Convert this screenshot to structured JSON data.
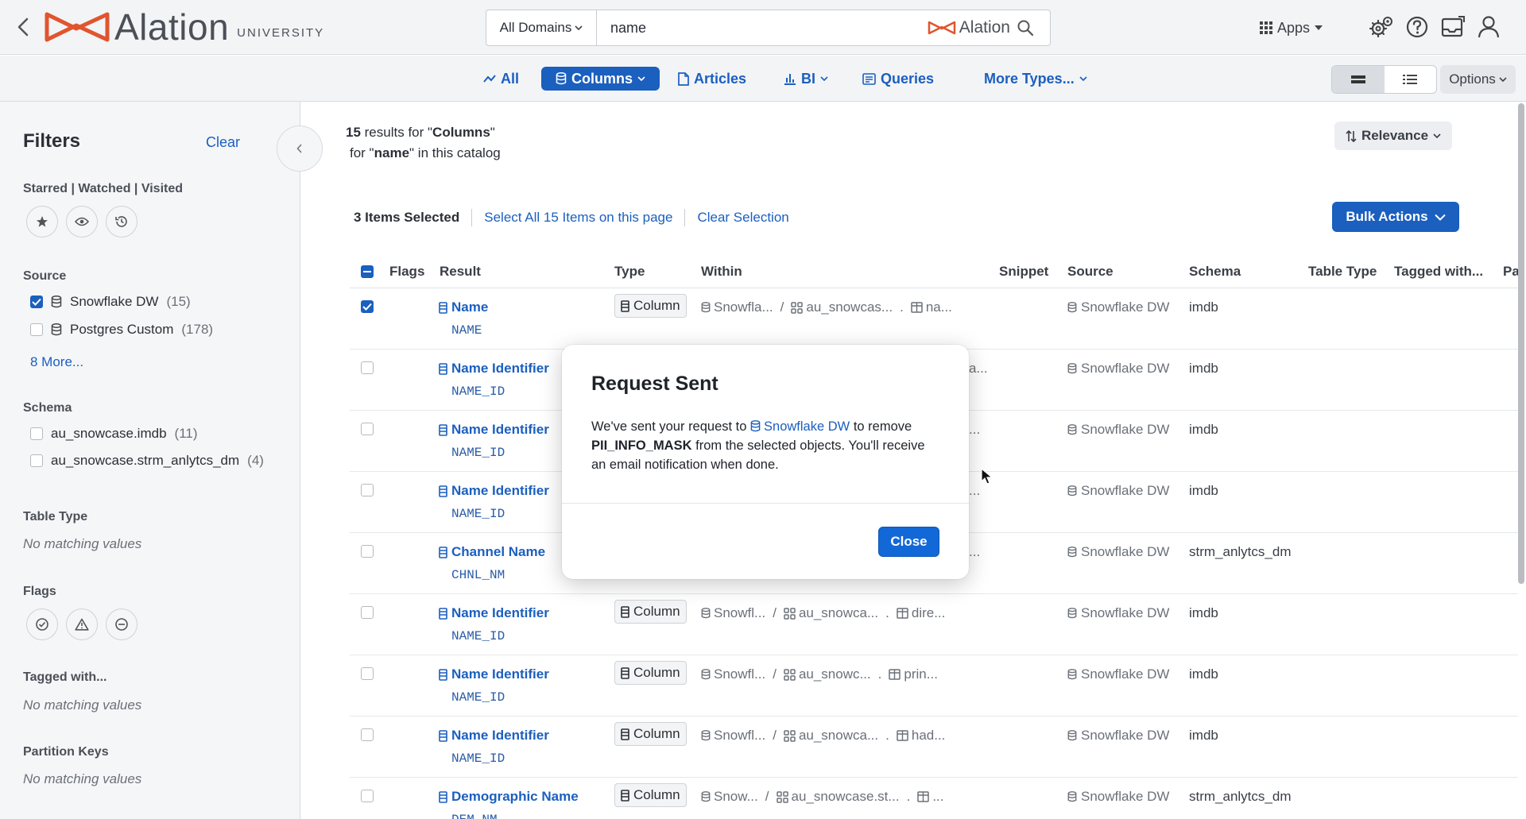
{
  "topbar": {
    "logo_word": "Alation",
    "logo_sub": "UNIVERSITY",
    "domain_selector": "All Domains",
    "search_value": "name",
    "search_brand": "Alation",
    "apps_label": "Apps"
  },
  "type_nav": {
    "all": "All",
    "columns": "Columns",
    "articles": "Articles",
    "bi": "BI",
    "queries": "Queries",
    "more_types": "More Types...",
    "options": "Options"
  },
  "sidebar": {
    "title": "Filters",
    "clear": "Clear",
    "starred_label": "Starred | Watched | Visited",
    "source_label": "Source",
    "sources": [
      {
        "name": "Snowflake DW",
        "count": "(15)",
        "checked": true
      },
      {
        "name": "Postgres Custom",
        "count": "(178)",
        "checked": false
      }
    ],
    "source_more": "8 More...",
    "schema_label": "Schema",
    "schemas": [
      {
        "name": "au_snowcase.imdb",
        "count": "(11)"
      },
      {
        "name": "au_snowcase.strm_anlytcs_dm",
        "count": "(4)"
      }
    ],
    "table_type_label": "Table Type",
    "table_type_empty": "No matching values",
    "flags_label": "Flags",
    "tagged_label": "Tagged with...",
    "tagged_empty": "No matching values",
    "partition_label": "Partition Keys",
    "partition_empty": "No matching values"
  },
  "summary": {
    "count": "15",
    "line1_mid": " results for \"",
    "type": "Columns",
    "line1_end": "\"",
    "line2_start": "for \"",
    "query": "name",
    "line2_end": "\" in this catalog"
  },
  "relevance": "Relevance",
  "selection": {
    "count_label": "3 Items Selected",
    "select_all": "Select All 15 Items on this page",
    "clear": "Clear Selection"
  },
  "bulk_actions": "Bulk Actions",
  "table": {
    "headers": {
      "flags": "Flags",
      "result": "Result",
      "type": "Type",
      "within": "Within",
      "snippet": "Snippet",
      "source": "Source",
      "schema": "Schema",
      "table_type": "Table Type",
      "tagged": "Tagged with...",
      "pa": "Pa"
    },
    "rows": [
      {
        "title": "Name",
        "tech": "NAME",
        "type": "Column",
        "w1": "Snowfla...",
        "w2": "au_snowcas...",
        "w3": "na...",
        "source": "Snowflake DW",
        "schema": "imdb",
        "checked": true
      },
      {
        "title": "Name Identifier",
        "tech": "NAME_ID",
        "type": "",
        "w1": "",
        "w2": "",
        "w3": "a...",
        "source": "Snowflake DW",
        "schema": "imdb",
        "checked": false
      },
      {
        "title": "Name Identifier",
        "tech": "NAME_ID",
        "type": "",
        "w1": "",
        "w2": "",
        "w3": "...",
        "source": "Snowflake DW",
        "schema": "imdb",
        "checked": false
      },
      {
        "title": "Name Identifier",
        "tech": "NAME_ID",
        "type": "",
        "w1": "",
        "w2": "",
        "w3": "...",
        "source": "Snowflake DW",
        "schema": "imdb",
        "checked": false
      },
      {
        "title": "Channel Name",
        "tech": "CHNL_NM",
        "type": "",
        "w1": "",
        "w2": "",
        "w3": "...",
        "source": "Snowflake DW",
        "schema": "strm_anlytcs_dm",
        "checked": false
      },
      {
        "title": "Name Identifier",
        "tech": "NAME_ID",
        "type": "Column",
        "w1": "Snowfl...",
        "w2": "au_snowca...",
        "w3": "dire...",
        "source": "Snowflake DW",
        "schema": "imdb",
        "checked": false
      },
      {
        "title": "Name Identifier",
        "tech": "NAME_ID",
        "type": "Column",
        "w1": "Snowfl...",
        "w2": "au_snowc...",
        "w3": "prin...",
        "source": "Snowflake DW",
        "schema": "imdb",
        "checked": false
      },
      {
        "title": "Name Identifier",
        "tech": "NAME_ID",
        "type": "Column",
        "w1": "Snowfl...",
        "w2": "au_snowca...",
        "w3": "had...",
        "source": "Snowflake DW",
        "schema": "imdb",
        "checked": false
      },
      {
        "title": "Demographic Name",
        "tech": "DEM_NM",
        "type": "Column",
        "w1": "Snow...",
        "w2": "au_snowcase.st...",
        "w3": "...",
        "source": "Snowflake DW",
        "schema": "strm_anlytcs_dm",
        "checked": false
      }
    ]
  },
  "modal": {
    "title": "Request Sent",
    "text_before": "We've sent your request to ",
    "link": "Snowflake DW",
    "text_mid": " to remove ",
    "mask": "PII_INFO_MASK",
    "text_after": " from the selected objects. You'll receive an email notification when done.",
    "close": "Close"
  },
  "colors": {
    "accent": "#1b5fbf",
    "brand": "#e0552e",
    "button_primary": "#1368d8"
  }
}
